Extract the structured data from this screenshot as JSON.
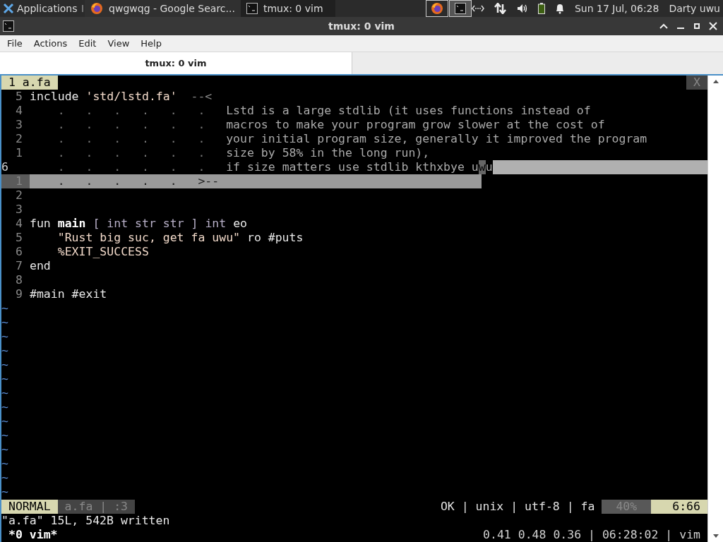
{
  "panel": {
    "apps_label": "Applications",
    "tasks": [
      {
        "title": "qwgwqg - Google Searc...",
        "kind": "browser",
        "selected": false
      },
      {
        "title": "tmux: 0 vim",
        "kind": "terminal",
        "selected": true
      }
    ],
    "clock": "Sun 17 Jul, 06:28",
    "user": "Darty uwu"
  },
  "window": {
    "title": "tmux: 0 vim"
  },
  "menu": [
    "File",
    "Actions",
    "Edit",
    "View",
    "Help"
  ],
  "tabs": [
    {
      "label": "tmux: 0 vim",
      "selected": true
    }
  ],
  "vim": {
    "tabline": {
      "label": "1 a.fa",
      "close": "X"
    },
    "lines": [
      {
        "number": "5",
        "current": false,
        "selected": false,
        "selected_to_end": false,
        "segments": [
          {
            "kind": "plain",
            "text": "include "
          },
          {
            "kind": "string",
            "text": "'std/lstd.fa'"
          },
          {
            "kind": "dim",
            "text": "  --<"
          }
        ]
      },
      {
        "number": "4",
        "current": false,
        "selected": false,
        "selected_to_end": false,
        "segments": [
          {
            "kind": "dots",
            "text": "    .   .   .   .   .   .   "
          },
          {
            "kind": "comment",
            "text": "Lstd is a large stdlib (it uses functions instead of"
          }
        ]
      },
      {
        "number": "3",
        "current": false,
        "selected": false,
        "selected_to_end": false,
        "segments": [
          {
            "kind": "dots",
            "text": "    .   .   .   .   .   .   "
          },
          {
            "kind": "comment",
            "text": "macros to make your program grow slower at the cost of"
          }
        ]
      },
      {
        "number": "2",
        "current": false,
        "selected": false,
        "selected_to_end": false,
        "segments": [
          {
            "kind": "dots",
            "text": "    .   .   .   .   .   .   "
          },
          {
            "kind": "comment",
            "text": "your initial program size, generally it improved the program"
          }
        ]
      },
      {
        "number": "1",
        "current": false,
        "selected": false,
        "selected_to_end": false,
        "segments": [
          {
            "kind": "dots",
            "text": "    .   .   .   .   .   .   "
          },
          {
            "kind": "comment",
            "text": "size by 58% in the long run),"
          }
        ]
      },
      {
        "number": "6",
        "current": true,
        "selected": false,
        "selected_to_end": true,
        "segments": [
          {
            "kind": "dots",
            "text": "    .   .   .   .   .   .   "
          },
          {
            "kind": "comment",
            "text": "if size matters use stdlib kthxbye u"
          },
          {
            "kind": "cursor",
            "text": "w"
          },
          {
            "kind": "comment",
            "text": "u"
          }
        ]
      },
      {
        "number": "1",
        "current": false,
        "selected": true,
        "selected_to_end": false,
        "segments": [
          {
            "kind": "seldots",
            "text": "    .   .   .   .   .   >--"
          }
        ]
      },
      {
        "number": "2",
        "current": false,
        "selected": false,
        "selected_to_end": false
      },
      {
        "number": "3",
        "current": false,
        "selected": false,
        "selected_to_end": false
      },
      {
        "number": "4",
        "current": false,
        "selected": false,
        "selected_to_end": false,
        "segments": [
          {
            "kind": "plain",
            "text": "fun "
          },
          {
            "kind": "bold",
            "text": "main"
          },
          {
            "kind": "type",
            "text": " [ int str str ] int "
          },
          {
            "kind": "plain",
            "text": "eo"
          }
        ]
      },
      {
        "number": "5",
        "current": false,
        "selected": false,
        "selected_to_end": false,
        "segments": [
          {
            "kind": "string",
            "text": "    \"Rust big suc, get fa uwu\""
          },
          {
            "kind": "plain",
            "text": " ro #puts"
          }
        ]
      },
      {
        "number": "6",
        "current": false,
        "selected": false,
        "selected_to_end": false,
        "segments": [
          {
            "kind": "string",
            "text": "    %EXIT_SUCCESS"
          }
        ]
      },
      {
        "number": "7",
        "current": false,
        "selected": false,
        "selected_to_end": false,
        "segments": [
          {
            "kind": "plain",
            "text": "end"
          }
        ]
      },
      {
        "number": "8",
        "current": false,
        "selected": false,
        "selected_to_end": false
      },
      {
        "number": "9",
        "current": false,
        "selected": false,
        "selected_to_end": false,
        "segments": [
          {
            "kind": "plain",
            "text": "#main #exit"
          }
        ]
      }
    ],
    "fillers": [
      "~",
      "~",
      "~",
      "~",
      "~",
      "~",
      "~",
      "~",
      "~",
      "~",
      "~",
      "~",
      "~",
      "~"
    ],
    "statusline": {
      "mode": "NORMAL",
      "file_info": "a.fa | :3",
      "info": "OK | unix | utf-8 | fa",
      "percent": "40%",
      "position": "6:66"
    },
    "message": "\"a.fa\" 15L, 542B written"
  },
  "tmux": {
    "window": "*0 vim*",
    "status": "0.41 0.48 0.36 | 06:28:02 | vim"
  }
}
